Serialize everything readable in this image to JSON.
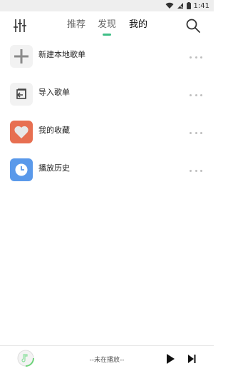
{
  "status_bar": {
    "time": "1:41"
  },
  "nav": {
    "tabs": [
      {
        "label": "推荐"
      },
      {
        "label": "发现"
      },
      {
        "label": "我的"
      }
    ],
    "accent": "#3fbf86"
  },
  "list": {
    "items": [
      {
        "label": "新建本地歌单",
        "icon": "plus-icon"
      },
      {
        "label": "导入歌单",
        "icon": "import-icon"
      },
      {
        "label": "我的收藏",
        "icon": "heart-icon"
      },
      {
        "label": "播放历史",
        "icon": "clock-icon"
      }
    ]
  },
  "player": {
    "status": "--未在播放--"
  }
}
